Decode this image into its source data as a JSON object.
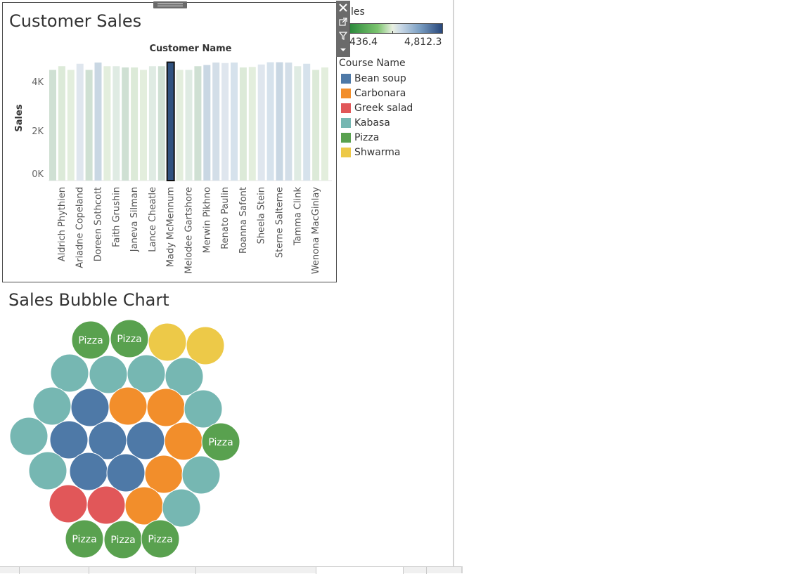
{
  "customer_sales": {
    "title": "Customer Sales",
    "header": "Customer Name",
    "y_axis_label": "Sales",
    "y_ticks": [
      "0K",
      "2K",
      "4K"
    ],
    "highlighted_customer": "Mady McMennum"
  },
  "bubble_chart": {
    "title": "Sales Bubble Chart",
    "bubble_label": "Pizza"
  },
  "color_legend": {
    "title_fragment": "les",
    "min_label": "436.4",
    "max_label": "4,812.3"
  },
  "course_legend": {
    "title": "Course Name",
    "items": [
      {
        "label": "Bean soup",
        "color": "#4e79a7"
      },
      {
        "label": "Carbonara",
        "color": "#f28e2b"
      },
      {
        "label": "Greek salad",
        "color": "#e15759"
      },
      {
        "label": "Kabasa",
        "color": "#76b7b2"
      },
      {
        "label": "Pizza",
        "color": "#59a14f"
      },
      {
        "label": "Shwarma",
        "color": "#edc948"
      }
    ]
  },
  "toolbar": {
    "close_icon": "close-icon",
    "open_icon": "open-external-icon",
    "filter_icon": "filter-icon",
    "more_icon": "caret-down-icon"
  },
  "chart_data": [
    {
      "type": "bar",
      "title": "Customer Sales",
      "xlabel": "Customer Name",
      "ylabel": "Sales",
      "ylim": [
        0,
        5000
      ],
      "y_ticks": [
        0,
        2000,
        4000
      ],
      "categories": [
        "",
        "Aldrich Phythien",
        "",
        "Ariadne Copeland",
        "",
        "Doreen Sothcott",
        "",
        "Faith Grushin",
        "",
        "Janeva Silman",
        "",
        "Lance Cheatle",
        "",
        "Mady McMennum",
        "",
        "Melodee Gartshore",
        "",
        "Merwin Pikhno",
        "",
        "Renato Paulin",
        "",
        "Roanna Safont",
        "",
        "Sheela Stein",
        "",
        "Sterne Salterne",
        "",
        "Tamma Clink",
        "",
        "Wenona MacGinlay",
        ""
      ],
      "values": [
        4500,
        4650,
        4500,
        4750,
        4500,
        4800,
        4650,
        4650,
        4600,
        4600,
        4500,
        4650,
        4650,
        4812.3,
        4500,
        4500,
        4650,
        4700,
        4800,
        4780,
        4800,
        4600,
        4620,
        4720,
        4812,
        4812,
        4800,
        4650,
        4750,
        4500,
        4600
      ]
    },
    {
      "type": "bubble",
      "title": "Sales Bubble Chart",
      "points": [
        {
          "course": "Pizza",
          "label": "Pizza"
        },
        {
          "course": "Pizza",
          "label": "Pizza"
        },
        {
          "course": "Shwarma",
          "label": ""
        },
        {
          "course": "Shwarma",
          "label": ""
        },
        {
          "course": "Kabasa",
          "label": ""
        },
        {
          "course": "Kabasa",
          "label": ""
        },
        {
          "course": "Kabasa",
          "label": ""
        },
        {
          "course": "Kabasa",
          "label": ""
        },
        {
          "course": "Kabasa",
          "label": ""
        },
        {
          "course": "Bean soup",
          "label": ""
        },
        {
          "course": "Carbonara",
          "label": ""
        },
        {
          "course": "Carbonara",
          "label": ""
        },
        {
          "course": "Kabasa",
          "label": ""
        },
        {
          "course": "Kabasa",
          "label": ""
        },
        {
          "course": "Bean soup",
          "label": ""
        },
        {
          "course": "Bean soup",
          "label": ""
        },
        {
          "course": "Bean soup",
          "label": ""
        },
        {
          "course": "Carbonara",
          "label": ""
        },
        {
          "course": "Pizza",
          "label": "Pizza"
        },
        {
          "course": "Kabasa",
          "label": ""
        },
        {
          "course": "Bean soup",
          "label": ""
        },
        {
          "course": "Bean soup",
          "label": ""
        },
        {
          "course": "Carbonara",
          "label": ""
        },
        {
          "course": "Kabasa",
          "label": ""
        },
        {
          "course": "Greek salad",
          "label": ""
        },
        {
          "course": "Greek salad",
          "label": ""
        },
        {
          "course": "Carbonara",
          "label": ""
        },
        {
          "course": "Kabasa",
          "label": ""
        },
        {
          "course": "Pizza",
          "label": "Pizza"
        },
        {
          "course": "Pizza",
          "label": "Pizza"
        },
        {
          "course": "Pizza",
          "label": "Pizza"
        }
      ]
    }
  ]
}
